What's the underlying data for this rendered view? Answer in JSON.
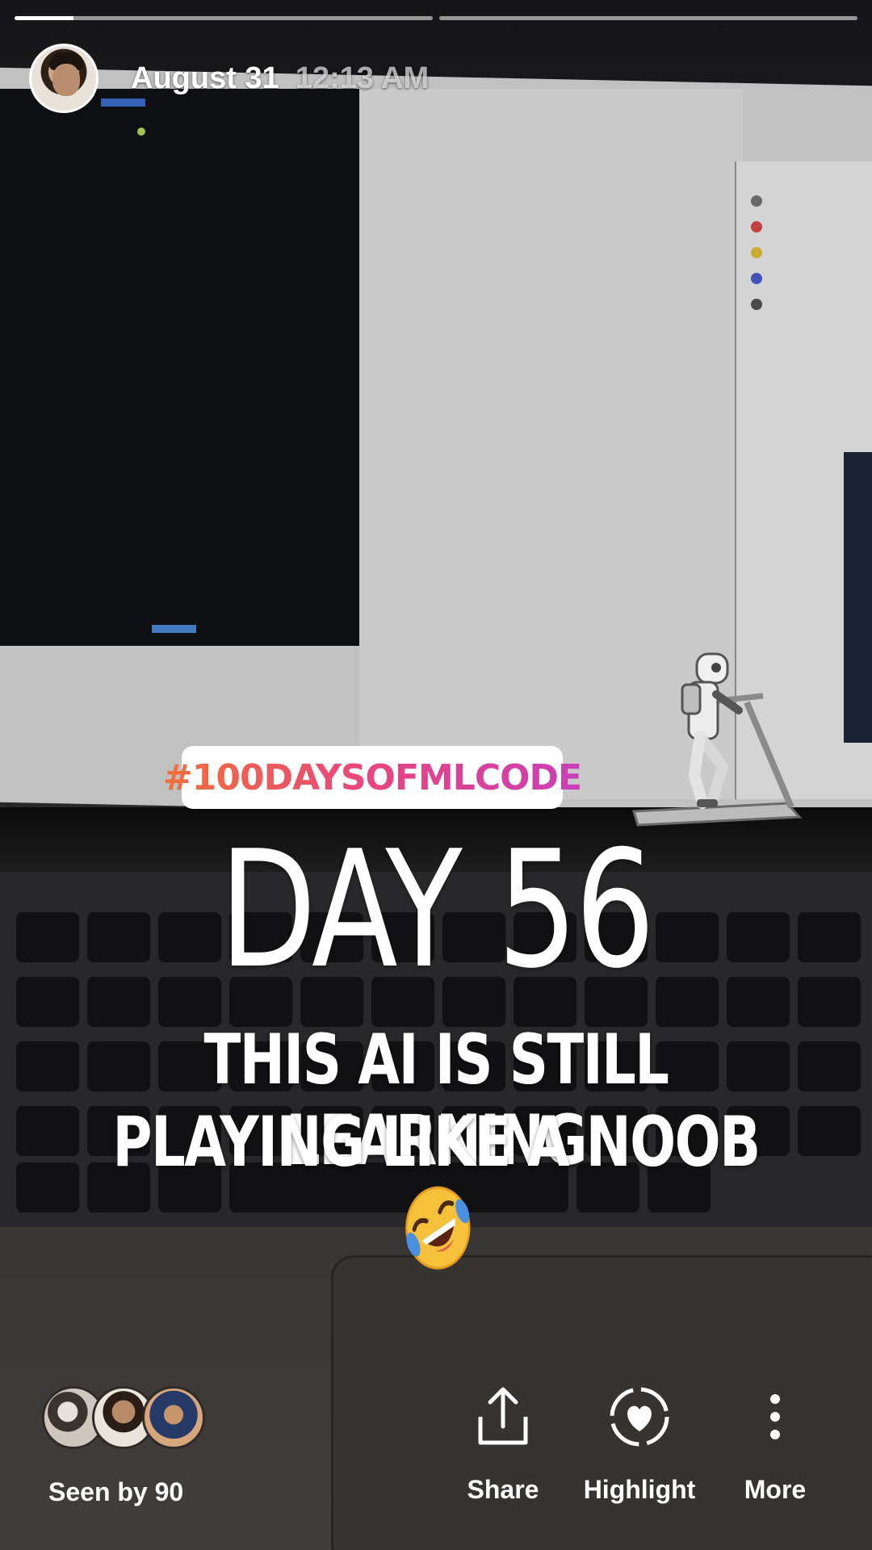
{
  "story": {
    "progress": [
      1,
      0
    ],
    "current_progress_fraction": 0.14
  },
  "header": {
    "date": "August 31",
    "time": "12:13 AM"
  },
  "stickers": {
    "hashtag": "#100DAYSOFMLCODE",
    "robot_icon": "robot-on-treadmill-icon"
  },
  "text_overlay": {
    "title": "DAY 56",
    "line1": "THIS AI IS STILL LEARNING",
    "line2": "PLAYING LIKE A NOOB",
    "emoji": "rolling-on-floor-laughing-emoji"
  },
  "footer": {
    "seen_by": "Seen by 90",
    "actions": {
      "share": "Share",
      "highlight": "Highlight",
      "more": "More"
    }
  },
  "colors": {
    "hashtag_gradient": [
      "#f0703a",
      "#e8457f",
      "#c93fb8"
    ],
    "text": "#ffffff"
  }
}
